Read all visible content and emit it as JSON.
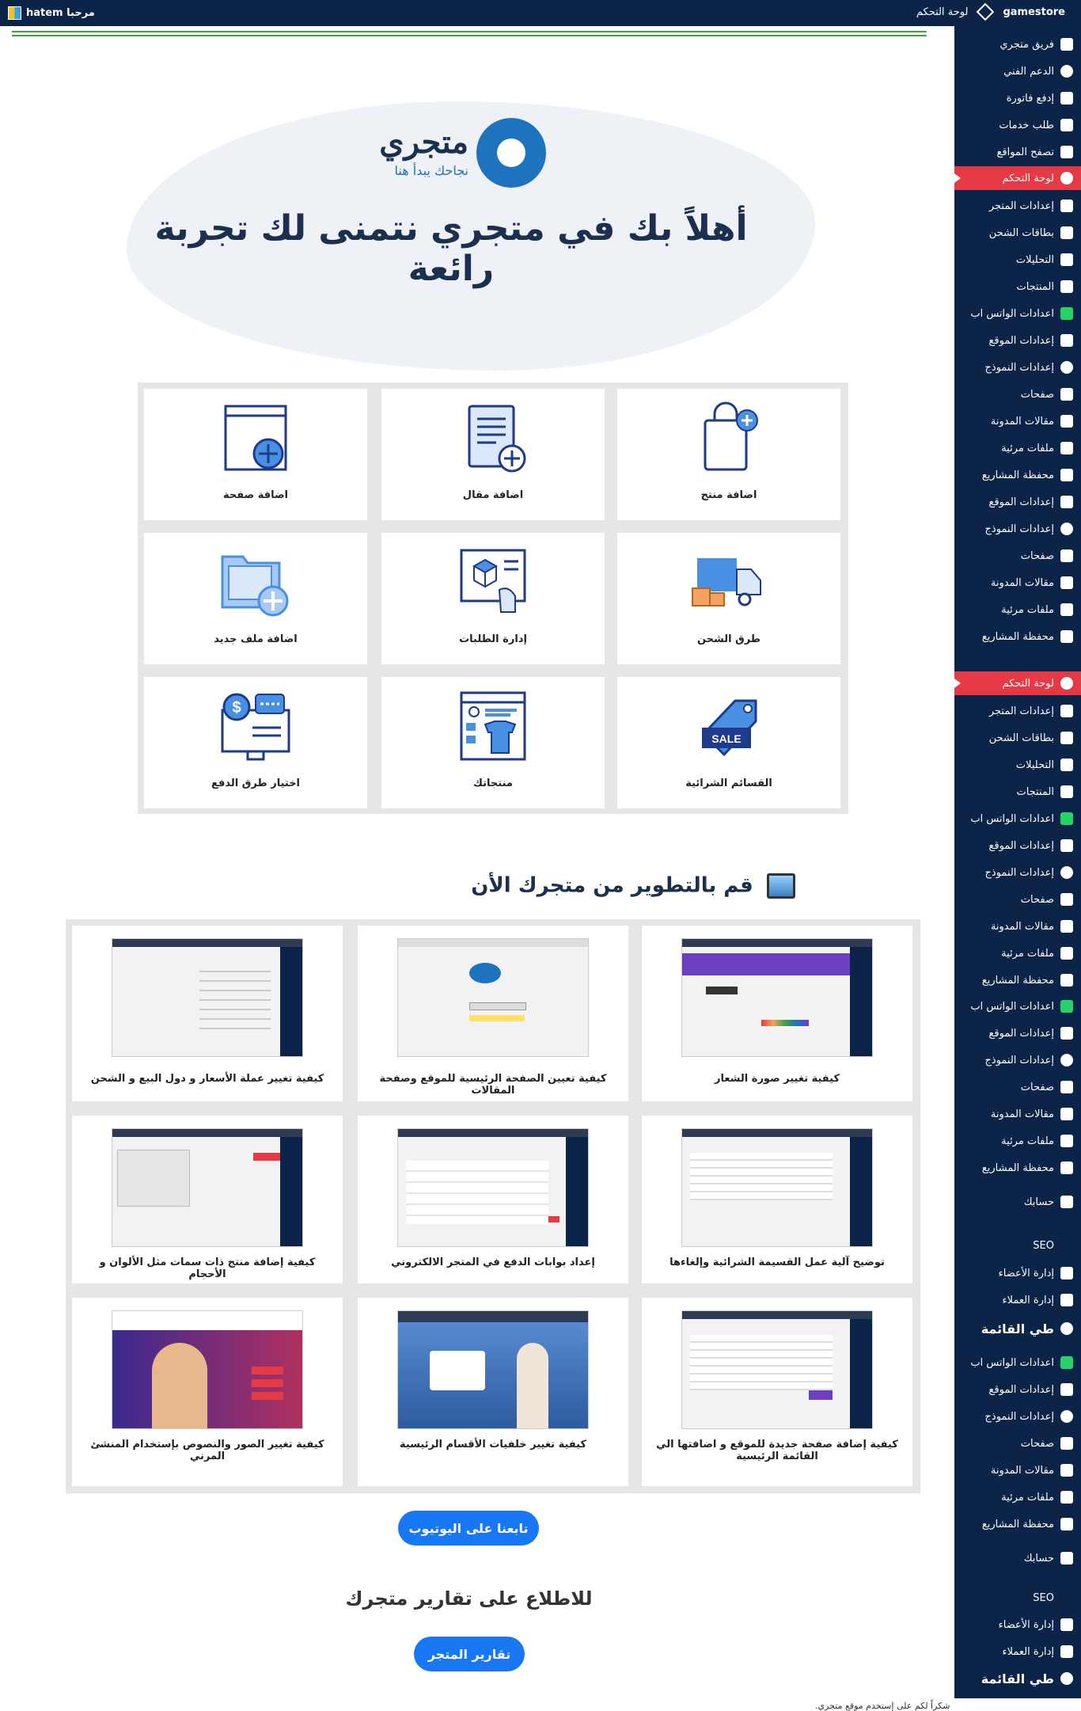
{
  "topbar": {
    "greeting": "مرحبا hatem",
    "dashboard_link": "لوحة التحكم",
    "store_name": "gamestore"
  },
  "brand": {
    "logo_name": "متجري",
    "logo_tagline": "نجاحك يبدأ هنا",
    "welcome": "أهلاً بك في متجري نتمنى لك تجربة رائعة"
  },
  "actions": [
    {
      "label": "اضافة منتج",
      "icon": "shopping-bag-plus-icon"
    },
    {
      "label": "اضافة مقال",
      "icon": "document-plus-icon"
    },
    {
      "label": "اضافة صفحة",
      "icon": "window-plus-icon"
    },
    {
      "label": "طرق الشحن",
      "icon": "truck-icon"
    },
    {
      "label": "إدارة الطلبات",
      "icon": "invoice-box-icon"
    },
    {
      "label": "اضافة ملف جديد",
      "icon": "folder-plus-icon"
    },
    {
      "label": "القسائم الشرائية",
      "icon": "sale-tag-icon"
    },
    {
      "label": "منتجاتك",
      "icon": "browser-shirt-icon"
    },
    {
      "label": "اختيار طرق الدفع",
      "icon": "monitor-dollar-icon"
    }
  ],
  "dev_section": {
    "title": "قم بالتطوير من متجرك الأن"
  },
  "videos": [
    {
      "label": "كيفية تغيير صورة الشعار"
    },
    {
      "label": "كيفية تعيين الصفحة الرئيسية للموقع وصفحة المقالات"
    },
    {
      "label": "كيفية تغيير عملة الأسعار و دول البيع و الشحن"
    },
    {
      "label": "توضيح آلية عمل القسيمة الشرائية وإلغاءها"
    },
    {
      "label": "إعداد بوابات الدفع في المتجر الالكتروني"
    },
    {
      "label": "كيفية إضافة منتج ذات سمات مثل الألوان و الأحجام"
    },
    {
      "label": "كيفية إضافة صفحة جديدة للموقع و اضافتها الي القائمة الرئيسية"
    },
    {
      "label": "كيفية تغيير خلفيات الأقسام الرئيسية"
    },
    {
      "label": "كيفية تغيير الصور والنصوص بإستخدام المنشئ المرني"
    }
  ],
  "buttons": {
    "youtube": "تابعنا على اليوتيوب",
    "reports": "تقارير المتجر"
  },
  "reports_title": "للاطلاع على تقارير متجرك",
  "footer_text": "شكراً لكم على إستخدم موقع متجري.",
  "sidebar": [
    {
      "label": "فريق متجري",
      "icon": "team-icon"
    },
    {
      "label": "الدعم الفني",
      "icon": "support-globe-icon"
    },
    {
      "label": "إدفع فاتورة",
      "icon": "credit-card-icon"
    },
    {
      "label": "طلب خدمات",
      "icon": "cart-icon"
    },
    {
      "label": "تصفح المواقع",
      "icon": "images-icon"
    },
    {
      "label": "لوحة التحكم",
      "icon": "dashboard-icon",
      "active": true
    },
    {
      "label": "إعدادات المتجر",
      "icon": "store-icon"
    },
    {
      "label": "بطاقات الشحن",
      "icon": "lock-icon"
    },
    {
      "label": "التحليلات",
      "icon": "bar-chart-icon"
    },
    {
      "label": "المنتجات",
      "icon": "bag-icon"
    },
    {
      "label": "اعدادات الواتس اب",
      "icon": "whatsapp-icon"
    },
    {
      "label": "إعدادات الموقع",
      "icon": "plus-box-icon"
    },
    {
      "label": "إعدادات النموذج",
      "icon": "d-circle-icon"
    },
    {
      "label": "صفحات",
      "icon": "pages-icon"
    },
    {
      "label": "مقالات المدونة",
      "icon": "pen-icon"
    },
    {
      "label": "ملفات مرئية",
      "icon": "image-icon"
    },
    {
      "label": "محفظة المشاريع",
      "icon": "portfolio-icon"
    },
    {
      "label": "إعدادات الموقع",
      "icon": "plus-box-icon"
    },
    {
      "label": "إعدادات النموذج",
      "icon": "d-circle-icon"
    },
    {
      "label": "صفحات",
      "icon": "pages-icon"
    },
    {
      "label": "مقالات المدونة",
      "icon": "pen-icon"
    },
    {
      "label": "ملفات مرئية",
      "icon": "image-icon"
    },
    {
      "label": "محفظة المشاريع",
      "icon": "portfolio-icon"
    },
    {
      "label": "لوحة التحكم",
      "icon": "dashboard-icon",
      "active": true
    },
    {
      "label": "إعدادات المتجر",
      "icon": "store-icon"
    },
    {
      "label": "بطاقات الشحن",
      "icon": "lock-icon"
    },
    {
      "label": "التحليلات",
      "icon": "bar-chart-icon"
    },
    {
      "label": "المنتجات",
      "icon": "bag-icon"
    },
    {
      "label": "اعدادات الواتس اب",
      "icon": "whatsapp-icon"
    },
    {
      "label": "إعدادات الموقع",
      "icon": "plus-box-icon"
    },
    {
      "label": "إعدادات النموذج",
      "icon": "d-circle-icon"
    },
    {
      "label": "صفحات",
      "icon": "pages-icon"
    },
    {
      "label": "مقالات المدونة",
      "icon": "pen-icon"
    },
    {
      "label": "ملفات مرئية",
      "icon": "image-icon"
    },
    {
      "label": "محفظة المشاريع",
      "icon": "portfolio-icon"
    },
    {
      "label": "اعدادات الواتس اب",
      "icon": "whatsapp-icon"
    },
    {
      "label": "إعدادات الموقع",
      "icon": "plus-box-icon"
    },
    {
      "label": "إعدادات النموذج",
      "icon": "d-circle-icon"
    },
    {
      "label": "صفحات",
      "icon": "pages-icon"
    },
    {
      "label": "مقالات المدونة",
      "icon": "pen-icon"
    },
    {
      "label": "ملفات مرئية",
      "icon": "image-icon"
    },
    {
      "label": "محفظة المشاريع",
      "icon": "portfolio-icon"
    },
    {
      "label": "حسابك",
      "icon": "user-icon"
    },
    {
      "label": "SEO",
      "icon": "seo-icon"
    },
    {
      "label": "إدارة الأعضاء",
      "icon": "members-icon"
    },
    {
      "label": "إدارة العملاء",
      "icon": "clients-icon"
    },
    {
      "label": "طي القائمة",
      "icon": "collapse-icon",
      "big": true
    },
    {
      "label": "اعدادات الواتس اب",
      "icon": "whatsapp-icon"
    },
    {
      "label": "إعدادات الموقع",
      "icon": "plus-box-icon"
    },
    {
      "label": "إعدادات النموذج",
      "icon": "d-circle-icon"
    },
    {
      "label": "صفحات",
      "icon": "pages-icon"
    },
    {
      "label": "مقالات المدونة",
      "icon": "pen-icon"
    },
    {
      "label": "ملفات مرئية",
      "icon": "image-icon"
    },
    {
      "label": "محفظة المشاريع",
      "icon": "portfolio-icon"
    },
    {
      "label": "حسابك",
      "icon": "user-icon"
    },
    {
      "label": "SEO",
      "icon": "seo-icon"
    },
    {
      "label": "إدارة الأعضاء",
      "icon": "members-icon"
    },
    {
      "label": "إدارة العملاء",
      "icon": "clients-icon"
    },
    {
      "label": "طي القائمة",
      "icon": "collapse-icon",
      "big": true
    }
  ],
  "colors": {
    "navy": "#0b2447",
    "accent_red": "#e63946",
    "brand_blue": "#1e73be",
    "button_blue": "#1877f2",
    "line_green": "#43a047"
  }
}
